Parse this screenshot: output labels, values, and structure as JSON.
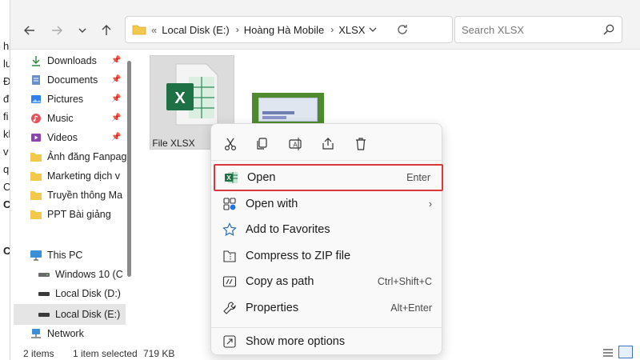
{
  "background_doc": {
    "lines": [
      "h",
      "lu",
      "Đ",
      "đ",
      "fi",
      "kh",
      "v",
      "q",
      "C",
      "C",
      "C"
    ]
  },
  "toolbar": {
    "address": {
      "prefix": "«",
      "segments": [
        "Local Disk (E:)",
        "Hoàng Hà Mobile",
        "XLSX"
      ]
    },
    "search_placeholder": "Search XLSX"
  },
  "sidebar": {
    "quick_access": [
      {
        "label": "Downloads",
        "icon": "download-icon",
        "pinned": true
      },
      {
        "label": "Documents",
        "icon": "documents-icon",
        "pinned": true
      },
      {
        "label": "Pictures",
        "icon": "pictures-icon",
        "pinned": true
      },
      {
        "label": "Music",
        "icon": "music-icon",
        "pinned": true
      },
      {
        "label": "Videos",
        "icon": "videos-icon",
        "pinned": true
      },
      {
        "label": "Ảnh đăng Fanpag",
        "icon": "folder-icon",
        "pinned": false
      },
      {
        "label": "Marketing dịch v",
        "icon": "folder-icon",
        "pinned": false
      },
      {
        "label": "Truyền thông Ma",
        "icon": "folder-icon",
        "pinned": false
      },
      {
        "label": "PPT Bài giảng",
        "icon": "folder-icon",
        "pinned": false
      }
    ],
    "this_pc": {
      "label": "This PC",
      "icon": "pc-icon"
    },
    "drives": [
      {
        "label": "Windows 10 (C",
        "icon": "drive-icon"
      },
      {
        "label": "Local Disk (D:)",
        "icon": "drive-icon"
      },
      {
        "label": "Local Disk (E:)",
        "icon": "drive-icon",
        "selected": true
      }
    ],
    "network": {
      "label": "Network",
      "icon": "network-icon"
    }
  },
  "files": [
    {
      "name": "File XLSX",
      "type": "xlsx"
    },
    {
      "name": "",
      "type": "image"
    }
  ],
  "status": {
    "items": "2 items",
    "selected": "1 item selected",
    "size": "719 KB"
  },
  "context_menu": {
    "quick_actions": [
      "cut-icon",
      "copy-icon",
      "rename-icon",
      "share-icon",
      "delete-icon"
    ],
    "items": [
      {
        "label": "Open",
        "shortcut": "Enter",
        "icon": "excel-icon",
        "highlighted": true
      },
      {
        "label": "Open with",
        "shortcut": "",
        "icon": "open-with-icon",
        "submenu": true
      },
      {
        "label": "Add to Favorites",
        "shortcut": "",
        "icon": "star-icon"
      },
      {
        "label": "Compress to ZIP file",
        "shortcut": "",
        "icon": "zip-icon"
      },
      {
        "label": "Copy as path",
        "shortcut": "Ctrl+Shift+C",
        "icon": "path-icon"
      },
      {
        "label": "Properties",
        "shortcut": "Alt+Enter",
        "icon": "wrench-icon"
      },
      {
        "label": "Show more options",
        "shortcut": "",
        "icon": "more-options-icon"
      }
    ]
  },
  "colors": {
    "highlight_border": "#d9363e",
    "excel_green": "#1e7145",
    "folder_yellow": "#f2c94c",
    "accent_blue": "#1a73e8"
  }
}
